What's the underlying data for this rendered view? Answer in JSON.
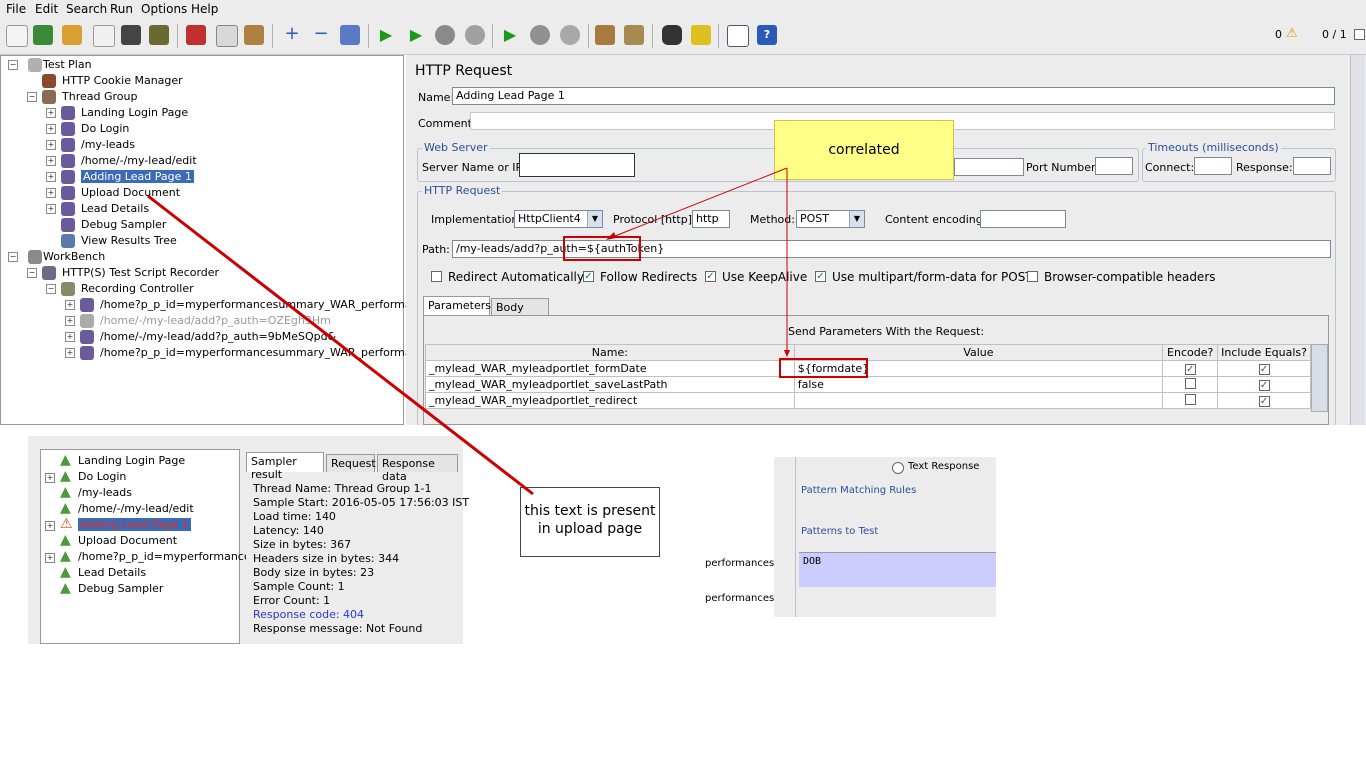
{
  "menubar": [
    "File",
    "Edit",
    "Search",
    "Run",
    "Options",
    "Help"
  ],
  "toolbar": {
    "warning_count": "0",
    "thread_count": "0 / 1"
  },
  "tree": [
    {
      "label": "Test Plan"
    },
    {
      "label": "HTTP Cookie Manager"
    },
    {
      "label": "Thread Group"
    },
    {
      "label": "Landing Login Page"
    },
    {
      "label": "Do Login"
    },
    {
      "label": "/my-leads"
    },
    {
      "label": "/home/-/my-lead/edit"
    },
    {
      "label": "Adding Lead Page 1"
    },
    {
      "label": "Upload Document"
    },
    {
      "label": "Lead Details"
    },
    {
      "label": "Debug Sampler"
    },
    {
      "label": "View Results Tree"
    },
    {
      "label": "WorkBench"
    },
    {
      "label": "HTTP(S) Test Script Recorder"
    },
    {
      "label": "Recording Controller"
    },
    {
      "label": "/home?p_p_id=myperformancesummary_WAR_performances"
    },
    {
      "label": "/home/-/my-lead/add?p_auth=OZEgh3Hm"
    },
    {
      "label": "/home/-/my-lead/add?p_auth=9bMeSQpd&"
    },
    {
      "label": "/home?p_p_id=myperformancesummary_WAR_performances"
    }
  ],
  "request": {
    "panel_title": "HTTP Request",
    "name_label": "Name:",
    "name_value": "Adding Lead Page 1",
    "comments_label": "Comments:",
    "web_server_title": "Web Server",
    "server_label": "Server Name or IP:",
    "port_label": "Port Number:",
    "timeouts_title": "Timeouts (milliseconds)",
    "connect_label": "Connect:",
    "response_label": "Response:",
    "http_request_title": "HTTP Request",
    "implementation_label": "Implementation:",
    "implementation_value": "HttpClient4",
    "protocol_label": "Protocol [http]:",
    "protocol_value": "http",
    "method_label": "Method:",
    "method_value": "POST",
    "encoding_label": "Content encoding:",
    "path_label": "Path:",
    "path_value": "/my-leads/add?p_auth=${authToken}",
    "checkboxes": [
      {
        "label": "Redirect Automatically",
        "checked": false
      },
      {
        "label": "Follow Redirects",
        "checked": true
      },
      {
        "label": "Use KeepAlive",
        "checked": true
      },
      {
        "label": "Use multipart/form-data for POST",
        "checked": true
      },
      {
        "label": "Browser-compatible headers",
        "checked": false
      }
    ],
    "tabs": [
      "Parameters",
      "Body Data"
    ],
    "params_caption": "Send Parameters With the Request:",
    "columns": [
      "Name:",
      "Value",
      "Encode?",
      "Include Equals?"
    ],
    "rows": [
      {
        "name": "_mylead_WAR_myleadportlet_formDate",
        "value": "${formdate}",
        "encode": true,
        "equals": true
      },
      {
        "name": "_mylead_WAR_myleadportlet_saveLastPath",
        "value": "false",
        "encode": false,
        "equals": true
      },
      {
        "name": "_mylead_WAR_myleadportlet_redirect",
        "value": "",
        "encode": false,
        "equals": true
      }
    ]
  },
  "note": "correlated",
  "callout": "this text is present in upload page",
  "results_tree": [
    {
      "label": "Landing Login Page",
      "status": "ok"
    },
    {
      "label": "Do Login",
      "status": "ok"
    },
    {
      "label": "/my-leads",
      "status": "ok"
    },
    {
      "label": "/home/-/my-lead/edit",
      "status": "ok"
    },
    {
      "label": "Adding Lead Page 1",
      "status": "error"
    },
    {
      "label": "Upload Document",
      "status": "ok"
    },
    {
      "label": "/home?p_p_id=myperformancesu",
      "status": "ok"
    },
    {
      "label": "Lead Details",
      "status": "ok"
    },
    {
      "label": "Debug Sampler",
      "status": "ok"
    }
  ],
  "results_tabs": [
    "Sampler result",
    "Request",
    "Response data"
  ],
  "sampler_result": [
    "Thread Name: Thread Group 1-1",
    "Sample Start: 2016-05-05 17:56:03 IST",
    "Load time: 140",
    "Latency: 140",
    "Size in bytes: 367",
    "Headers size in bytes: 344",
    "Body size in bytes: 23",
    "Sample Count: 1",
    "Error Count: 1",
    "Response code: 404",
    "Response message: Not Found"
  ],
  "assertion": {
    "text_response": "Text Response",
    "pattern_rules": "Pattern Matching Rules",
    "patterns_test": "Patterns to Test",
    "pattern_value": "DOB",
    "side_label_1": "performances",
    "side_label_2": "performances"
  },
  "colors": {
    "accent_red": "#cc0000",
    "note_yellow": "#ffff88",
    "selected_blue": "#3a6ab8"
  }
}
